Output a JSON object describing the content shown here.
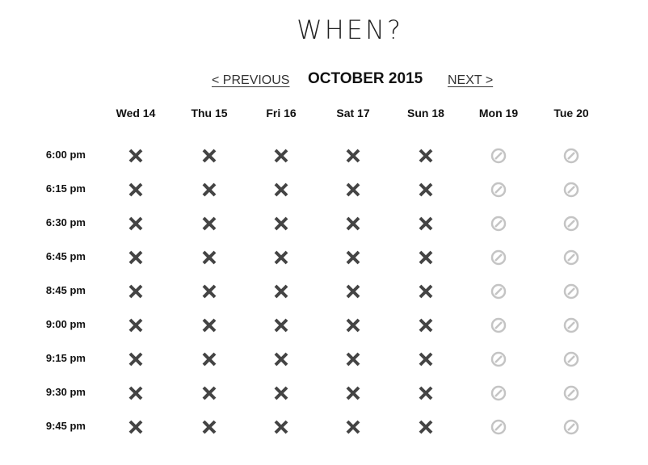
{
  "title": "WHEN?",
  "nav": {
    "previous_label": "< PREVIOUS",
    "month_label": "OCTOBER 2015",
    "next_label": "NEXT >"
  },
  "days": [
    {
      "label": "Wed 14",
      "status": "unavailable"
    },
    {
      "label": "Thu 15",
      "status": "unavailable"
    },
    {
      "label": "Fri 16",
      "status": "unavailable"
    },
    {
      "label": "Sat 17",
      "status": "unavailable"
    },
    {
      "label": "Sun 18",
      "status": "unavailable"
    },
    {
      "label": "Mon 19",
      "status": "closed"
    },
    {
      "label": "Tue 20",
      "status": "closed"
    }
  ],
  "times": [
    "6:00 pm",
    "6:15 pm",
    "6:30 pm",
    "6:45 pm",
    "8:45 pm",
    "9:00 pm",
    "9:15 pm",
    "9:30 pm",
    "9:45 pm"
  ],
  "icons": {
    "unavailable": "x-icon",
    "closed": "no-entry-icon"
  },
  "colors": {
    "unavailable": "#444444",
    "closed": "#c4c4c4"
  }
}
